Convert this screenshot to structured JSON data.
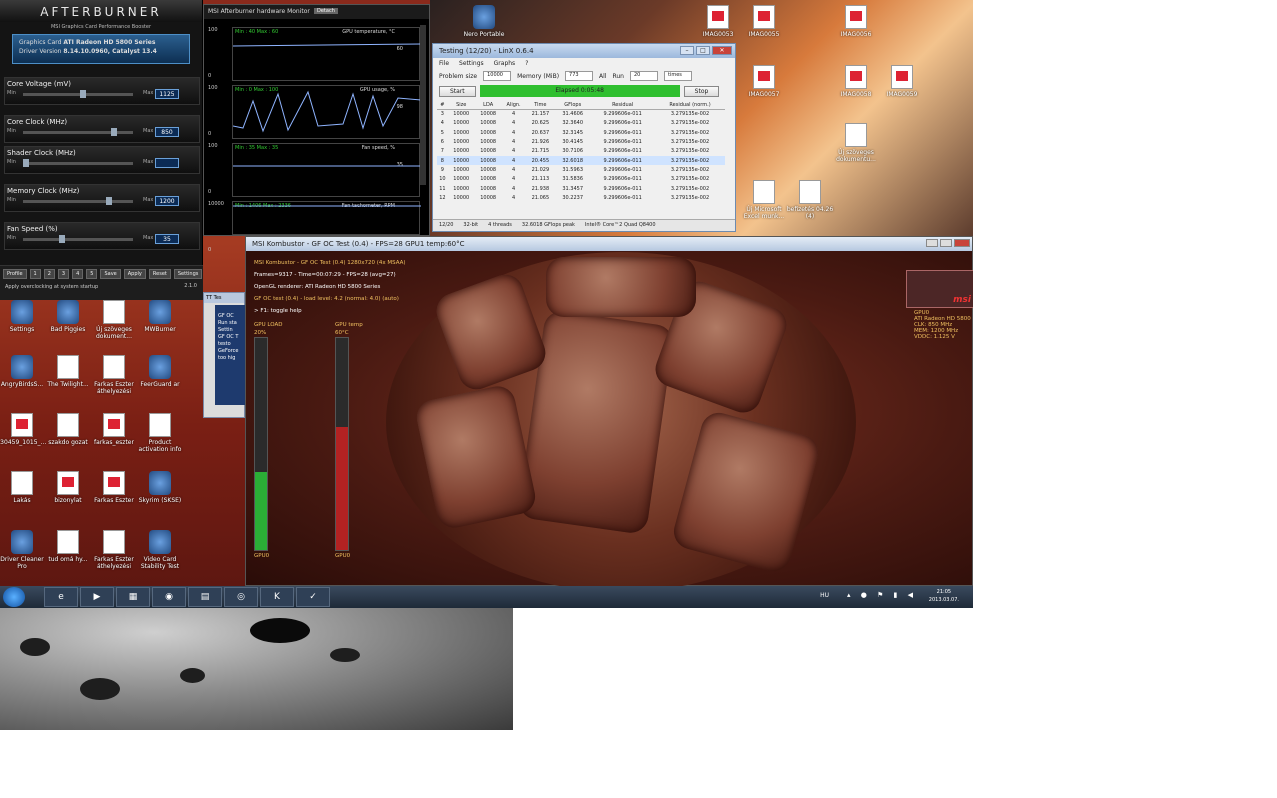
{
  "afterburner": {
    "logo": "AFTERBURNER",
    "subtitle": "MSI Graphics Card Performance Booster",
    "gpu_label": "Graphics Card",
    "gpu_name": "ATI Radeon HD 5800 Series",
    "driver_label": "Driver Version",
    "driver": "8.14.10.0960, Catalyst 13.4",
    "sliders": [
      {
        "label": "Core Voltage (mV)",
        "value": "1125",
        "pos": 0.55
      },
      {
        "label": "Core Clock (MHz)",
        "value": "850",
        "pos": 0.85
      },
      {
        "label": "Shader Clock (MHz)",
        "value": "",
        "pos": 0
      },
      {
        "label": "Memory Clock (MHz)",
        "value": "1200",
        "pos": 0.8
      },
      {
        "label": "Fan Speed (%)",
        "value": "35",
        "pos": 0.35
      }
    ],
    "min": "Min",
    "max": "Max",
    "auto": "Auto",
    "profile": "Profile",
    "save": "Save",
    "apply": "Apply",
    "reset": "Reset",
    "settings": "Settings",
    "status": "Apply overclocking at system startup",
    "version": "2.1.0",
    "powered": "Powered by RivaTuner"
  },
  "monitor": {
    "title": "MSI Afterburner hardware Monitor",
    "detach": "Detach",
    "graphs": [
      {
        "label": "GPU temperature, °C",
        "minmax": "Min : 40  Max : 60",
        "value": "60",
        "ymax": "100",
        "ymin": "0"
      },
      {
        "label": "GPU usage, %",
        "minmax": "Min : 0  Max : 100",
        "value": "98",
        "ymax": "100",
        "ymin": "0"
      },
      {
        "label": "Fan speed, %",
        "minmax": "Min : 35  Max : 35",
        "value": "35",
        "ymax": "100",
        "ymin": "0"
      },
      {
        "label": "Fan tachometer, RPM",
        "minmax": "Min : 1406  Max : 2336",
        "value": "",
        "ymax": "10000",
        "ymin": "0"
      }
    ]
  },
  "linx": {
    "title": "Testing (12/20) - LinX 0.6.4",
    "menu": [
      "File",
      "Settings",
      "Graphs",
      "?"
    ],
    "problem_size_label": "Problem size",
    "problem_size": "10000",
    "memory_label": "Memory (MiB)",
    "memory": "773",
    "all": "All",
    "run_label": "Run",
    "runs": "20",
    "times": "times",
    "start": "Start",
    "progress": "Elapsed 0:05:48",
    "stop": "Stop",
    "headers": [
      "#",
      "Size",
      "LDA",
      "Align.",
      "Time",
      "GFlops",
      "Residual",
      "Residual (norm.)"
    ],
    "rows": [
      [
        "3",
        "10000",
        "10008",
        "4",
        "21.157",
        "31.4606",
        "9.299606e-011",
        "3.279135e-002"
      ],
      [
        "4",
        "10000",
        "10008",
        "4",
        "20.625",
        "32.3640",
        "9.299606e-011",
        "3.279135e-002"
      ],
      [
        "5",
        "10000",
        "10008",
        "4",
        "20.637",
        "32.3145",
        "9.299606e-011",
        "3.279135e-002"
      ],
      [
        "6",
        "10000",
        "10008",
        "4",
        "21.926",
        "30.4145",
        "9.299606e-011",
        "3.279135e-002"
      ],
      [
        "7",
        "10000",
        "10008",
        "4",
        "21.715",
        "30.7106",
        "9.299606e-011",
        "3.279135e-002"
      ],
      [
        "8",
        "10000",
        "10008",
        "4",
        "20.455",
        "32.6018",
        "9.299606e-011",
        "3.279135e-002"
      ],
      [
        "9",
        "10000",
        "10008",
        "4",
        "21.029",
        "31.5963",
        "9.299606e-011",
        "3.279135e-002"
      ],
      [
        "10",
        "10000",
        "10008",
        "4",
        "21.113",
        "31.5836",
        "9.299606e-011",
        "3.279135e-002"
      ],
      [
        "11",
        "10000",
        "10008",
        "4",
        "21.938",
        "31.3457",
        "9.299606e-011",
        "3.279135e-002"
      ],
      [
        "12",
        "10000",
        "10008",
        "4",
        "21.065",
        "30.2237",
        "9.299606e-011",
        "3.279135e-002"
      ]
    ],
    "status": [
      "12/20",
      "32-bit",
      "4 threads",
      "32.6018 GFlops peak",
      "Intel® Core™2 Quad Q8400"
    ]
  },
  "kombustor": {
    "title": "MSI Kombustor - GF OC Test (0.4) - FPS=28 GPU1 temp:60°C",
    "lines": [
      "MSI Kombustor - GF OC Test (0.4) 1280x720 (4x MSAA)",
      "Frames=9317 - Time=00:07:29 - FPS=28 (avg=27)",
      "OpenGL renderer: ATI Radeon HD 5800 Series",
      "GF OC test (0.4) - load level: 4.2 (normal: 4.0) (auto)",
      "> F1: toggle help"
    ],
    "gpu_load_label": "GPU LOAD",
    "gpu_load": "20%",
    "gpu_load_frac": 0.37,
    "gpu_temp_label": "GPU temp",
    "gpu_temp": "60°C",
    "gpu_temp_frac": 0.58,
    "gpu0": "GPU0",
    "card_info": [
      "GPU0",
      "ATI Radeon HD 5800",
      "CLK: 850 MHz",
      "MEM: 1200 MHz",
      "VDDC: 1.125 V"
    ],
    "msi": "msi"
  },
  "desktop_icons": [
    {
      "label": "Nero Portable",
      "type": "app"
    },
    {
      "label": "IMAG0053",
      "type": "pdf"
    },
    {
      "label": "IMAG0055",
      "type": "pdf"
    },
    {
      "label": "IMAG0056",
      "type": "pdf"
    },
    {
      "label": "IMAG0057",
      "type": "pdf"
    },
    {
      "label": "IMAG0058",
      "type": "pdf"
    },
    {
      "label": "IMAG0059",
      "type": "pdf"
    },
    {
      "label": "Új szöveges dokumentu...",
      "type": "doc"
    },
    {
      "label": "Új Microsoft Excel munk...",
      "type": "doc"
    },
    {
      "label": "befizetés 04.26 (4)",
      "type": "doc"
    },
    {
      "label": "Settings",
      "type": "app"
    },
    {
      "label": "Bad Piggies",
      "type": "app"
    },
    {
      "label": "Új szöveges dokument...",
      "type": "doc"
    },
    {
      "label": "MWBurner",
      "type": "app"
    },
    {
      "label": "AngryBirdsS...",
      "type": "app"
    },
    {
      "label": "The Twilight...",
      "type": "doc"
    },
    {
      "label": "Farkas Eszter áthelyezési",
      "type": "doc"
    },
    {
      "label": "FeerGuard ar",
      "type": "app"
    },
    {
      "label": "r30459_1015_...",
      "type": "pdf"
    },
    {
      "label": "szakdo gozat",
      "type": "doc"
    },
    {
      "label": "farkas_eszter",
      "type": "pdf"
    },
    {
      "label": "Product activation info",
      "type": "doc"
    },
    {
      "label": "Lakás",
      "type": "doc"
    },
    {
      "label": "bizonylat",
      "type": "pdf"
    },
    {
      "label": "Farkas Eszter",
      "type": "pdf"
    },
    {
      "label": "Skyrim (SKSE)",
      "type": "app"
    },
    {
      "label": "Driver Cleaner Pro",
      "type": "app"
    },
    {
      "label": "tud omá hy...",
      "type": "doc"
    },
    {
      "label": "Farkas Eszter áthelyezési",
      "type": "doc"
    },
    {
      "label": "Video Card Stability Test",
      "type": "app"
    }
  ],
  "small_window": {
    "title": "TT Tes",
    "lines": [
      "GF OC",
      "Run sta",
      "Settin",
      "GF OC T",
      "testo",
      "GeForce",
      "too hig"
    ]
  },
  "taskbar": {
    "lang": "HU",
    "time": "21:05",
    "date": "2013.03.07.",
    "apps": [
      "e",
      "▶",
      "▦",
      "◉",
      "▤",
      "◎",
      "K",
      "✓"
    ]
  }
}
